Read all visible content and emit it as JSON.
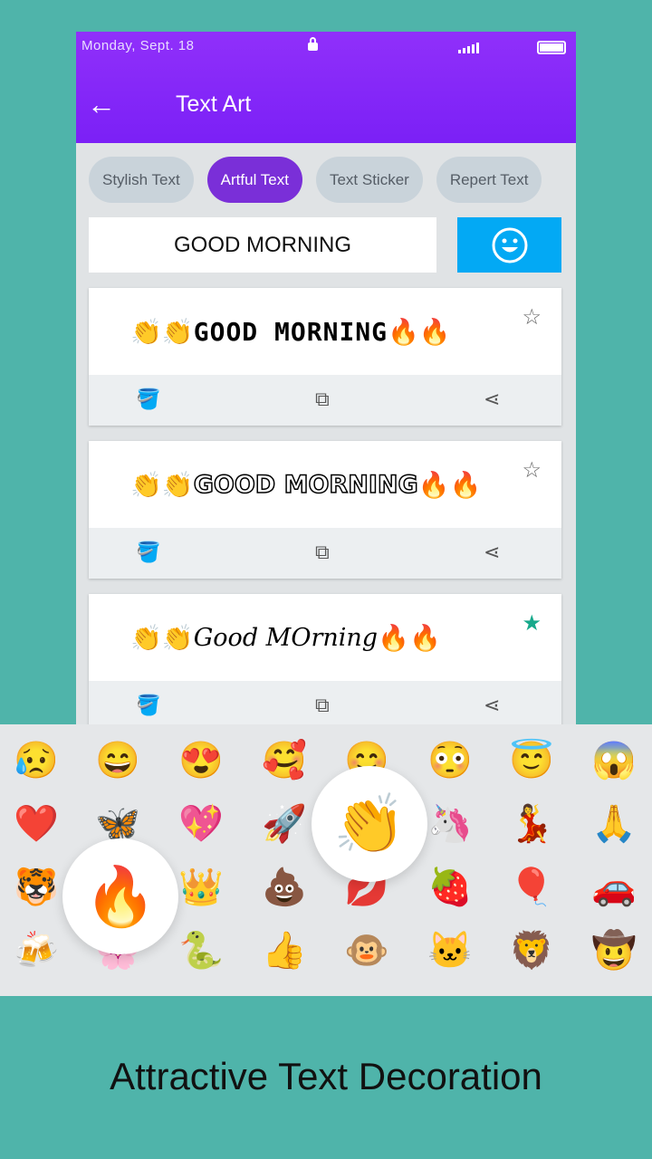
{
  "status": {
    "date": "Monday, Sept. 18",
    "icons": [
      "lock-icon",
      "signal-icon",
      "battery-icon"
    ]
  },
  "header": {
    "back_icon": "arrow-left-icon",
    "title": "Text Art"
  },
  "tabs": [
    {
      "label": "Stylish Text"
    },
    {
      "label": "Artful Text",
      "active": true
    },
    {
      "label": "Text Sticker"
    },
    {
      "label": "Repert Text"
    }
  ],
  "input": {
    "value": "GOOD MORNING"
  },
  "emoji_button": {
    "icon": "smiley-icon",
    "color": "#03a9f4"
  },
  "cards": [
    {
      "prefix": "👏👏",
      "text": "GOOD MORNING",
      "suffix": "🔥🔥",
      "favorite": false
    },
    {
      "prefix": "👏👏",
      "text": "GOOD MORNING",
      "suffix": "🔥🔥",
      "favorite": true,
      "_": 0
    },
    {
      "prefix": "👏👏",
      "text": "Good MOrning",
      "suffix": "🔥🔥",
      "favorite": true
    }
  ],
  "emoji_grid": [
    [
      "😥",
      "😄",
      "😍",
      "🥰",
      "😊",
      "😳",
      "😇",
      "😱"
    ],
    [
      "❤️",
      "🦋",
      "💖",
      "🚀",
      "",
      "🦄",
      "💃",
      "🙏"
    ],
    [
      "🐯",
      "",
      "👑",
      "💩",
      "💋",
      "🍓",
      "🎈",
      "🚗"
    ],
    [
      "🍻",
      "🌸",
      "🐍",
      "👍",
      "🐵",
      "🐱",
      "🦁",
      "🤠"
    ]
  ],
  "highlights": {
    "fire": "🔥",
    "clap": "👏"
  },
  "caption": "Attractive Text Decoration",
  "colors": {
    "background": "#4fb4aa",
    "header": "#8a2be2",
    "active_tab": "#7a2fd8",
    "favorite": "#17a98b"
  }
}
